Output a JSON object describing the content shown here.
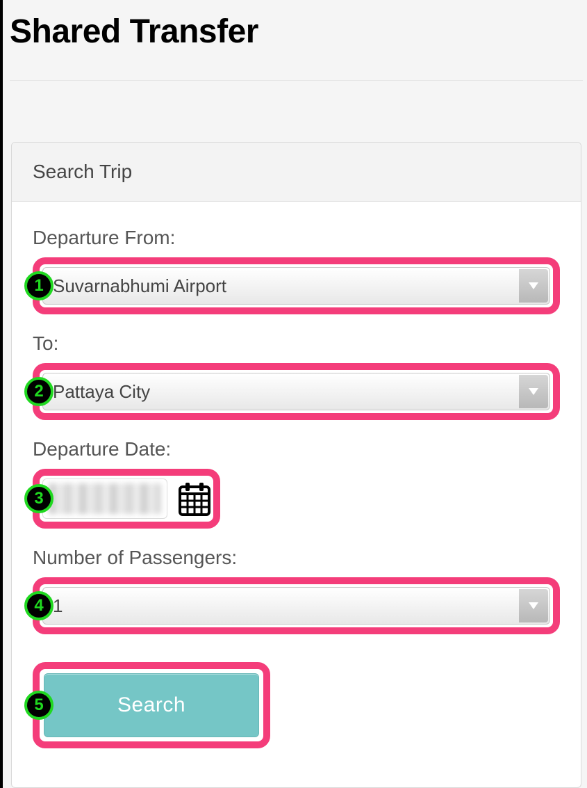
{
  "page": {
    "title": "Shared Transfer"
  },
  "panel": {
    "header": "Search Trip"
  },
  "form": {
    "departure_from": {
      "label": "Departure From:",
      "value": "Suvarnabhumi Airport"
    },
    "to": {
      "label": "To:",
      "value": "Pattaya City"
    },
    "departure_date": {
      "label": "Departure Date:",
      "value": ""
    },
    "passengers": {
      "label": "Number of Passengers:",
      "value": "1"
    },
    "search_button": "Search"
  },
  "annotations": {
    "badge1": "1",
    "badge2": "2",
    "badge3": "3",
    "badge4": "4",
    "badge5": "5"
  },
  "icons": {
    "dropdown_arrow": "chevron-down-icon",
    "calendar": "calendar-icon"
  }
}
